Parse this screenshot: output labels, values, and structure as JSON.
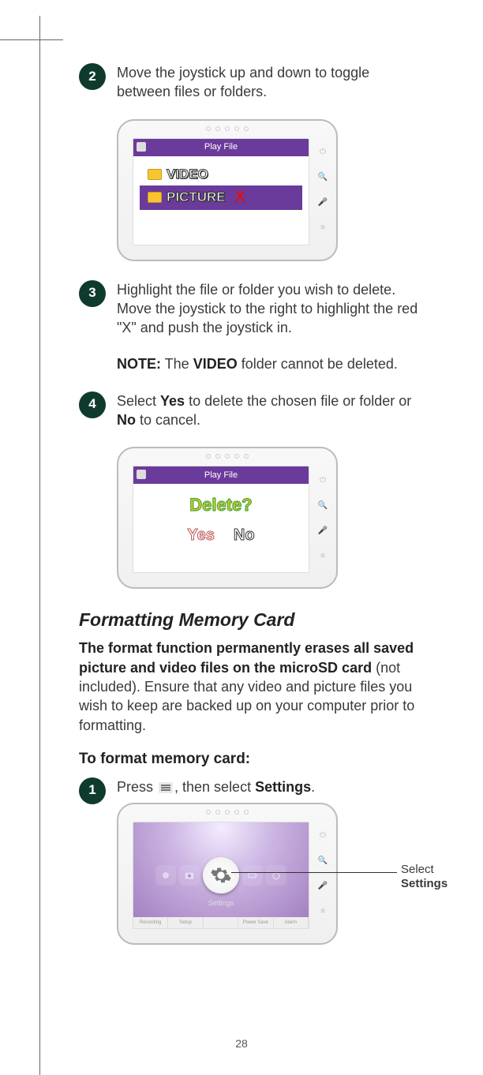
{
  "steps": {
    "s2": {
      "num": "2",
      "text_a": "Move the joystick up and down to toggle between files or folders."
    },
    "s3": {
      "num": "3",
      "text_a": "Highlight the file or folder you wish to delete. Move the joystick to the right to highlight the red \"X\" and push the joystick in."
    },
    "note": {
      "prefix": "NOTE:",
      "text": " The ",
      "bold": "VIDEO",
      "suffix": " folder cannot be deleted."
    },
    "s4": {
      "num": "4",
      "text_a": "Select ",
      "b1": "Yes",
      "text_b": " to delete the chosen file or folder or ",
      "b2": "No",
      "text_c": " to cancel."
    },
    "s1": {
      "num": "1",
      "text_a": "Press ",
      "text_b": ", then select ",
      "bold": "Settings",
      "suffix": "."
    }
  },
  "device1": {
    "title": "Play File",
    "row1": "VIDEO",
    "row2": "PICTURE",
    "x": "X"
  },
  "device2": {
    "title": "Play File",
    "question": "Delete?",
    "yes": "Yes",
    "no": "No"
  },
  "device3": {
    "center_label": "Settings",
    "tabs": [
      "Recording",
      "Setup",
      "",
      "Power Save",
      "Alarm"
    ]
  },
  "section": {
    "heading": "Formatting Memory Card",
    "lead_b": "The format function permanently erases all saved picture and video files on the microSD card",
    "lead_rest": " (not included). Ensure that any video and picture files you wish to keep are backed up on your computer prior to formatting.",
    "subhead": "To format memory card:"
  },
  "callout": {
    "line1": "Select",
    "line2": "Settings"
  },
  "page": "28"
}
